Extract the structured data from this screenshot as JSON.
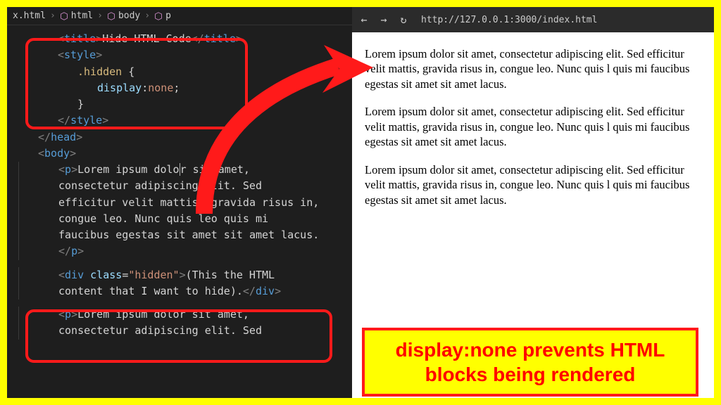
{
  "breadcrumb": {
    "file": "x.html",
    "items": [
      "html",
      "body",
      "p"
    ]
  },
  "code": {
    "l1_a": "title",
    "l1_txt": "Hide HTML Code",
    "l2": "style",
    "l3_sel": ".hidden",
    "l3_b": " {",
    "l4_prop": "display",
    "l4_colon": ":",
    "l4_val": "none",
    "l4_semi": ";",
    "l5": "}",
    "l6": "style",
    "l7": "head",
    "l8": "body",
    "l9": "p",
    "para1": "Lorem ipsum dolor sit amet, consectetur adipiscing elit. Sed efficitur velit mattis, gravida risus in, congue leo. Nunc quis leo quis mi faucibus egestas sit amet sit amet lacus.",
    "p1a": "Lorem ipsum dolo",
    "p1cur": "r",
    "p1b": " sit amet,",
    "p1c": "consectetur adipiscing elit. Se",
    "p1d": "d",
    "p1e": "efficitur velit mattis, gravid",
    "p1f": "a ",
    "p1g": "risus in,",
    "p1h": "congue leo. Nunc quis leo qu",
    "p1i": "is ",
    "p1j": "mi",
    "p1k": "faucibus egestas sit amet si",
    "p1l": "t ",
    "p1m": "amet lacus.",
    "div": "div",
    "cls": "class",
    "clsv": "\"hidden\"",
    "divtxt": "(This the HTML content that I want to hide).",
    "dA": "(This the HTML",
    "dB": "content that I want to hide).",
    "p2a": "Lorem ipsum dolor sit amet,",
    "p2b": "consectetur adipiscing elit. Sed"
  },
  "browser": {
    "url": "http://127.0.0.1:3000/index.html",
    "paragraph": "Lorem ipsum dolor sit amet, consectetur adipiscing elit. Sed efficitur velit mattis, gravida risus in, congue leo. Nunc quis l quis mi faucibus egestas sit amet sit amet lacus."
  },
  "caption": "display:none prevents HTML blocks being rendered"
}
